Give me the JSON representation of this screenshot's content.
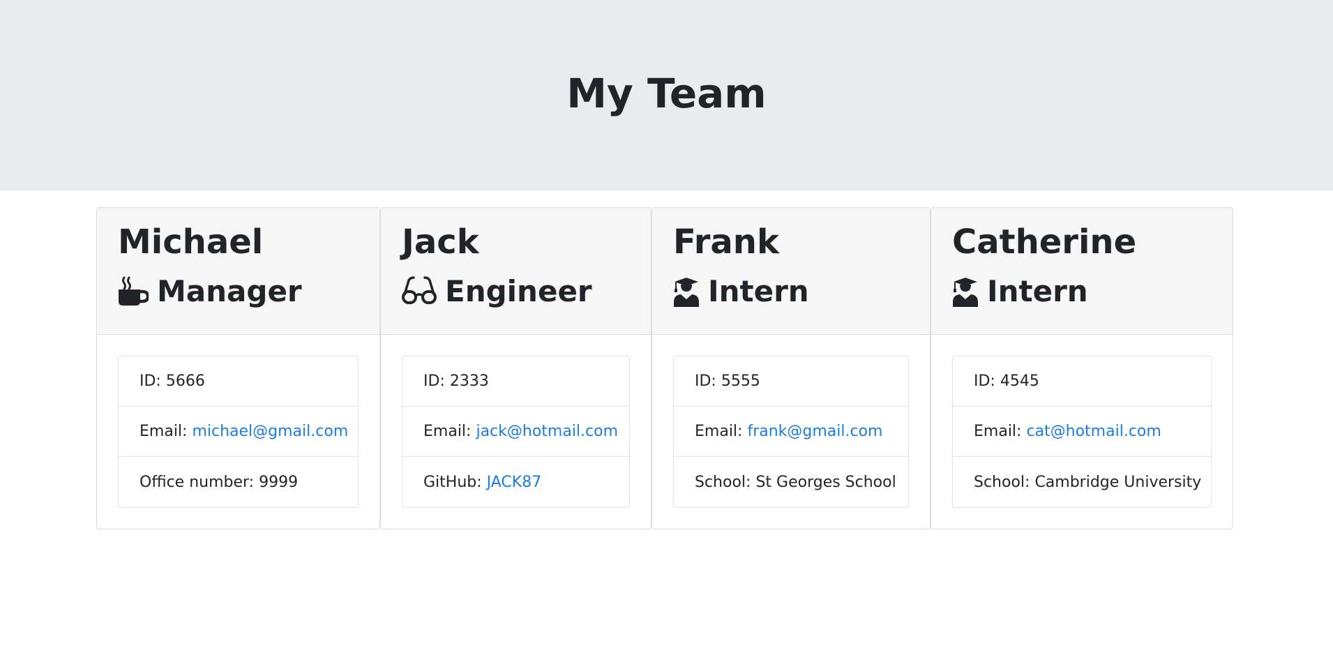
{
  "page": {
    "title": "My Team"
  },
  "colors": {
    "jumbotron_bg": "#e9ecef",
    "card_header_bg": "#f6f6f6",
    "link": "#1a7ce6",
    "text": "#212529"
  },
  "members": [
    {
      "name": "Michael",
      "role": "Manager",
      "role_icon": "coffee-mug-icon",
      "id_label": "ID: 5666",
      "email_prefix": "Email: ",
      "email": "michael@gmail.com",
      "extra_prefix": "Office number: 9999",
      "extra_link": ""
    },
    {
      "name": "Jack",
      "role": "Engineer",
      "role_icon": "glasses-icon",
      "id_label": "ID: 2333",
      "email_prefix": "Email: ",
      "email": "jack@hotmail.com",
      "extra_prefix": "GitHub: ",
      "extra_link": "JACK87"
    },
    {
      "name": "Frank",
      "role": "Intern",
      "role_icon": "graduate-icon",
      "id_label": "ID: 5555",
      "email_prefix": "Email: ",
      "email": "frank@gmail.com",
      "extra_prefix": "School: St Georges School",
      "extra_link": ""
    },
    {
      "name": "Catherine",
      "role": "Intern",
      "role_icon": "graduate-icon",
      "id_label": "ID: 4545",
      "email_prefix": "Email: ",
      "email": "cat@hotmail.com",
      "extra_prefix": "School: Cambridge University",
      "extra_link": ""
    }
  ]
}
